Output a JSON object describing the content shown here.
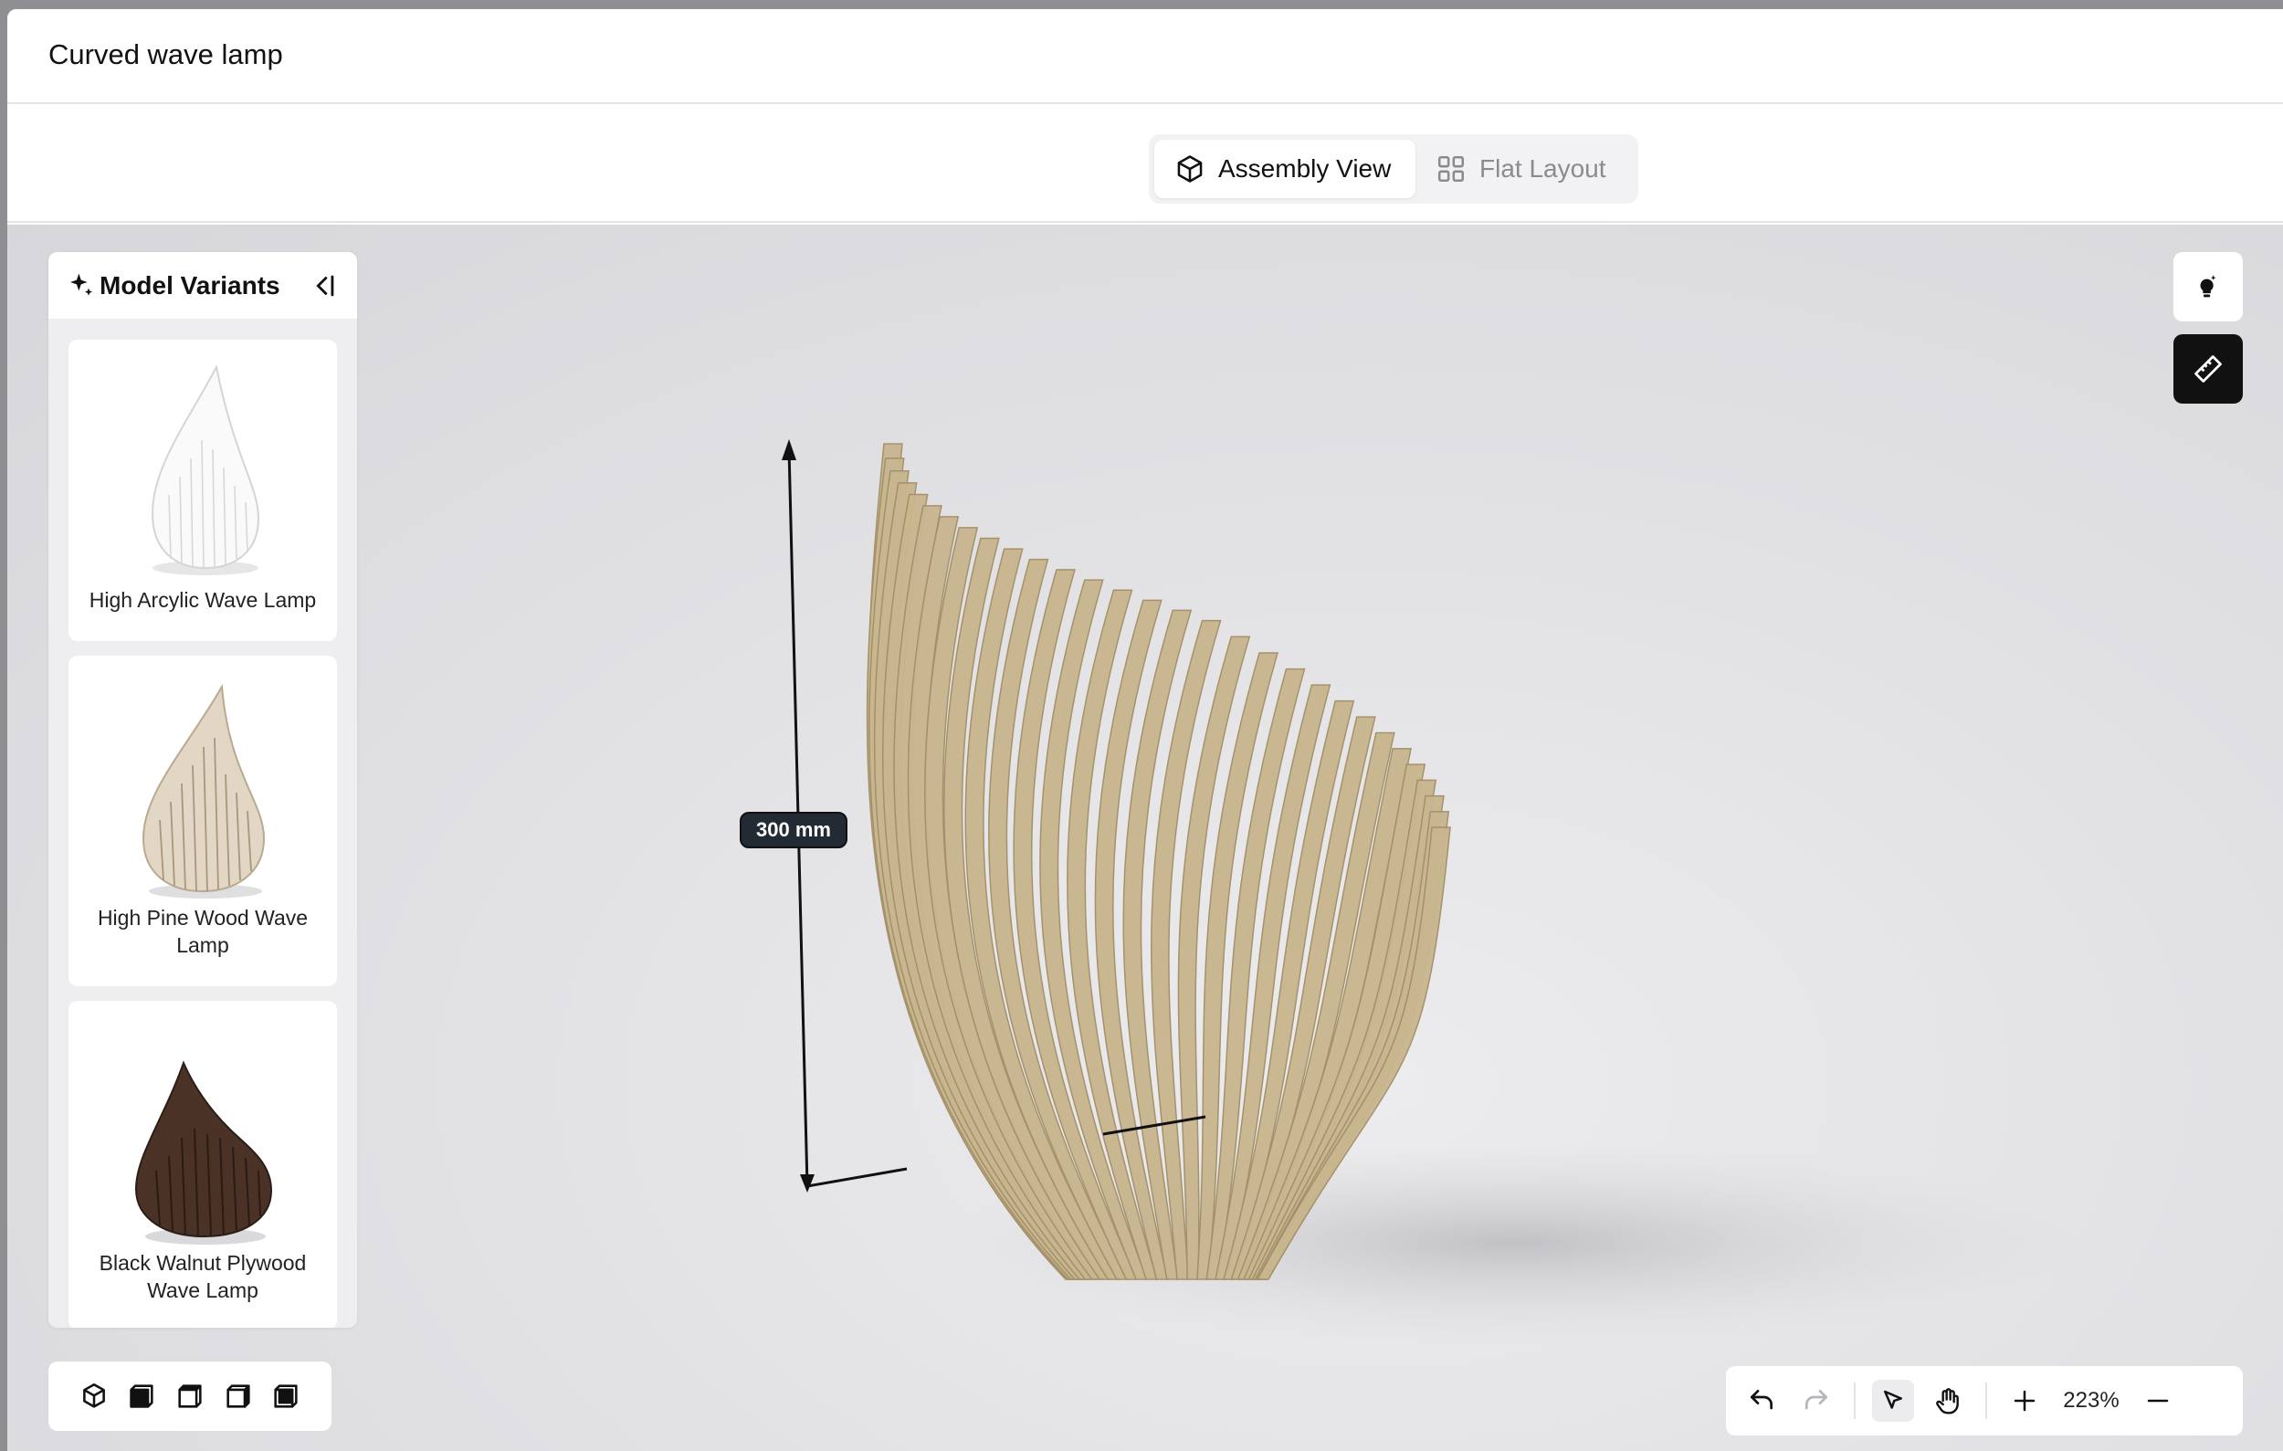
{
  "window": {
    "title": "Curved wave lamp"
  },
  "view_toggle": {
    "assembly_label": "Assembly View",
    "flat_label": "Flat Layout",
    "active": "Assembly View"
  },
  "variants_panel": {
    "title": "Model Variants",
    "items": [
      {
        "label": "High Arcylic Wave Lamp",
        "color": "#f4f4f4"
      },
      {
        "label": "High Pine Wood Wave Lamp",
        "color": "#d8c9b4"
      },
      {
        "label": "Black Walnut Plywood Wave Lamp",
        "color": "#4a3226"
      }
    ]
  },
  "viewport": {
    "dimension_label": "300 mm",
    "model_color": "#c8b68f"
  },
  "view_cubes": [
    "iso-view-icon",
    "front-view-icon",
    "top-view-icon",
    "right-view-icon",
    "left-view-icon"
  ],
  "side_tools": [
    "lighting-icon",
    "ruler-icon"
  ],
  "bottom_toolbar": {
    "zoom": "223%",
    "tools": [
      "undo-icon",
      "redo-icon",
      "select-icon",
      "pan-icon",
      "zoom-in-icon",
      "zoom-out-icon"
    ]
  },
  "colors": {
    "accent_dark": "#111111",
    "badge": "#222a33"
  }
}
